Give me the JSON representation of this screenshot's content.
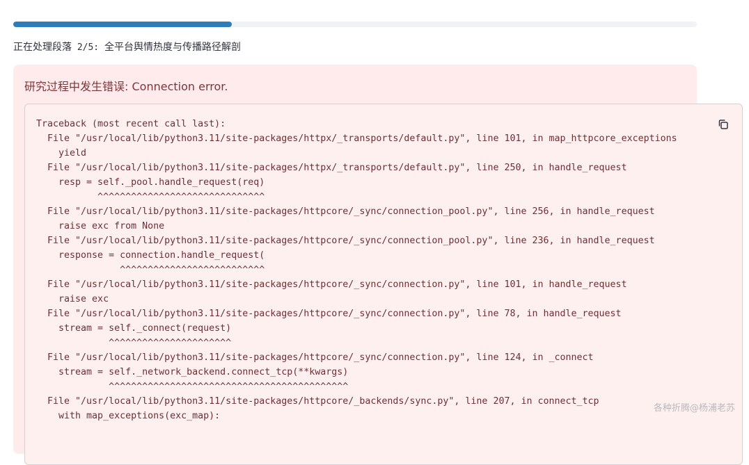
{
  "progress": {
    "fraction": 0.32,
    "fill_color": "#2e7db8",
    "track_color": "#f0f2f6",
    "label_prefix": "正在处理段落",
    "label_count": " 2/5: ",
    "label_section": "全平台舆情热度与传播路径解剖"
  },
  "error": {
    "title": "研究过程中发生错误: Connection error.",
    "background": "#ffebeb",
    "text_color": "#7d353b",
    "copy_icon": "copy-icon",
    "traceback": [
      "Traceback (most recent call last):",
      "  File \"/usr/local/lib/python3.11/site-packages/httpx/_transports/default.py\", line 101, in map_httpcore_exceptions",
      "    yield",
      "  File \"/usr/local/lib/python3.11/site-packages/httpx/_transports/default.py\", line 250, in handle_request",
      "    resp = self._pool.handle_request(req)",
      "           ^^^^^^^^^^^^^^^^^^^^^^^^^^^^^^",
      "  File \"/usr/local/lib/python3.11/site-packages/httpcore/_sync/connection_pool.py\", line 256, in handle_request",
      "    raise exc from None",
      "  File \"/usr/local/lib/python3.11/site-packages/httpcore/_sync/connection_pool.py\", line 236, in handle_request",
      "    response = connection.handle_request(",
      "               ^^^^^^^^^^^^^^^^^^^^^^^^^^",
      "  File \"/usr/local/lib/python3.11/site-packages/httpcore/_sync/connection.py\", line 101, in handle_request",
      "    raise exc",
      "  File \"/usr/local/lib/python3.11/site-packages/httpcore/_sync/connection.py\", line 78, in handle_request",
      "    stream = self._connect(request)",
      "             ^^^^^^^^^^^^^^^^^^^^^^",
      "  File \"/usr/local/lib/python3.11/site-packages/httpcore/_sync/connection.py\", line 124, in _connect",
      "    stream = self._network_backend.connect_tcp(**kwargs)",
      "             ^^^^^^^^^^^^^^^^^^^^^^^^^^^^^^^^^^^^^^^^^^^",
      "  File \"/usr/local/lib/python3.11/site-packages/httpcore/_backends/sync.py\", line 207, in connect_tcp",
      "    with map_exceptions(exc_map):"
    ]
  },
  "watermark": "各种折腾@杨浦老苏"
}
